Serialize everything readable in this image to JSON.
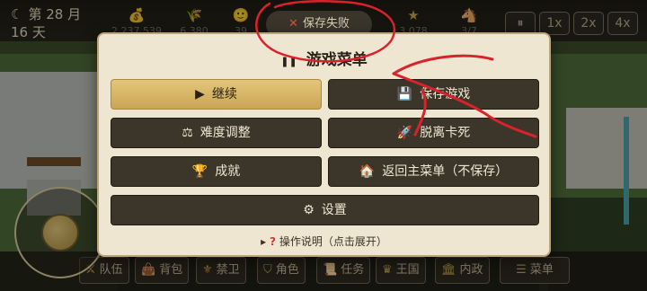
{
  "hud": {
    "date_line1": "第 28 月",
    "date_line2": "16 天",
    "resources": [
      {
        "icon": "money-bag-icon",
        "glyph": "💰",
        "value": "2,237,539"
      },
      {
        "icon": "wheat-icon",
        "glyph": "🌾",
        "value": "6,380"
      },
      {
        "icon": "smile-icon",
        "glyph": "🙂",
        "value": "39"
      },
      {
        "icon": "star-icon",
        "glyph": "★",
        "value": "3,078"
      },
      {
        "icon": "villager-icon",
        "glyph": "🐴",
        "value": "3/7"
      }
    ],
    "speed": [
      "⏸",
      "1x",
      "2x",
      "4x"
    ],
    "toast": "保存失败"
  },
  "modal": {
    "title": "游戏菜单",
    "buttons": {
      "continue": "继续",
      "save": "保存游戏",
      "difficulty": "难度调整",
      "unstuck": "脱离卡死",
      "achievements": "成就",
      "main_menu": "返回主菜单（不保存）",
      "settings": "设置"
    },
    "help": "操作说明（点击展开）"
  },
  "bottom_nav": [
    "队伍",
    "背包",
    "禁卫",
    "角色",
    "任务",
    "王国",
    "内政",
    "菜单"
  ],
  "colors": {
    "accent_gold": "#c9a553",
    "dark_button": "#3c352a",
    "panel": "#efe6d2",
    "annotation_red": "#d9222a"
  }
}
